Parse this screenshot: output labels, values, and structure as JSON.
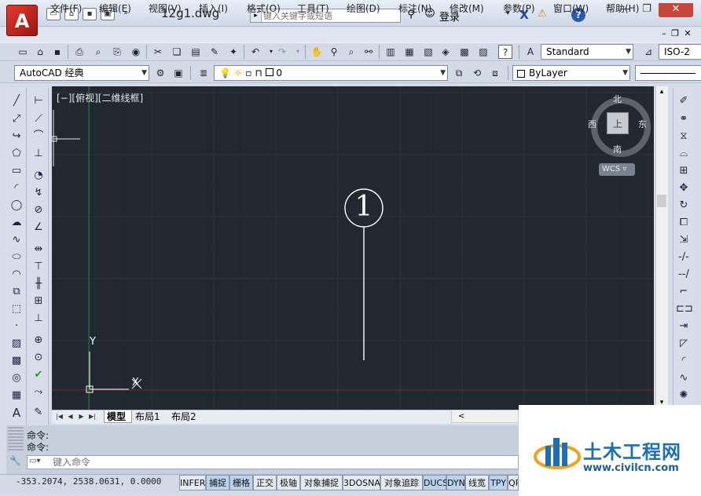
{
  "app": {
    "logo_letter": "A",
    "title": "12g1.dwg",
    "accent": "#c6463a"
  },
  "quick_access": [
    "new-icon",
    "open-icon",
    "save-icon",
    "saveas-icon",
    "more-icon"
  ],
  "search": {
    "placeholder": "键入关键字或短语"
  },
  "account": {
    "login_label": "登录"
  },
  "menu": [
    "文件(F)",
    "编辑(E)",
    "视图(V)",
    "插入(I)",
    "格式(O)",
    "工具(T)",
    "绘图(D)",
    "标注(N)",
    "修改(M)",
    "参数(P)",
    "窗口(W)",
    "帮助(H)"
  ],
  "toolbar": {
    "text_style": "Standard",
    "dim_style": "ISO-2",
    "workspace": "AutoCAD 经典",
    "layer": "0",
    "color": "ByLayer"
  },
  "canvas": {
    "view_label": "[−][俯视][二维线框]",
    "background": "#212830",
    "axis_y": "Y",
    "axis_x": "X",
    "marker_number": "1"
  },
  "viewcube": {
    "north": "北",
    "south": "南",
    "east": "东",
    "west": "西",
    "top_face": "上",
    "wcs": "WCS"
  },
  "layout_tabs": [
    "模型",
    "布局1",
    "布局2"
  ],
  "command": {
    "line1": "命令:",
    "line2": "命令:",
    "placeholder": "键入命令"
  },
  "status": {
    "coords": "-353.2074, 2538.0631, 0.0000",
    "buttons": [
      "INFER",
      "捕捉",
      "栅格",
      "正交",
      "极轴",
      "对象捕捉",
      "3DOSNAP",
      "对象追踪",
      "DUCS",
      "DYN",
      "线宽",
      "TPY",
      "QP"
    ]
  },
  "watermark": {
    "title": "土木工程网",
    "url": "www.civilcn.com"
  }
}
